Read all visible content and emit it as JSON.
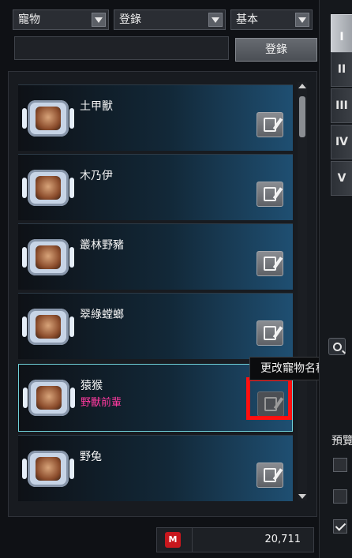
{
  "filters": {
    "category": "寵物",
    "status": "登錄",
    "mode": "基本",
    "register_label": "登錄"
  },
  "pets": [
    {
      "name": "土甲獸",
      "sub": ""
    },
    {
      "name": "木乃伊",
      "sub": ""
    },
    {
      "name": "叢林野豬",
      "sub": ""
    },
    {
      "name": "翠綠螳螂",
      "sub": ""
    },
    {
      "name": "猿猴",
      "sub": "野獸前輩"
    },
    {
      "name": "野兔",
      "sub": ""
    }
  ],
  "tooltip": "更改寵物名稱",
  "currency": {
    "icon": "M",
    "amount": "20,711"
  },
  "side_tabs": [
    "I",
    "II",
    "III",
    "IV",
    "V"
  ],
  "preview_label": "預覽",
  "checkboxes": [
    false,
    false,
    true
  ],
  "colors": {
    "selected_border": "#6fd0d8",
    "highlight": "#ff1010",
    "sub_name": "#ff3aa0"
  }
}
